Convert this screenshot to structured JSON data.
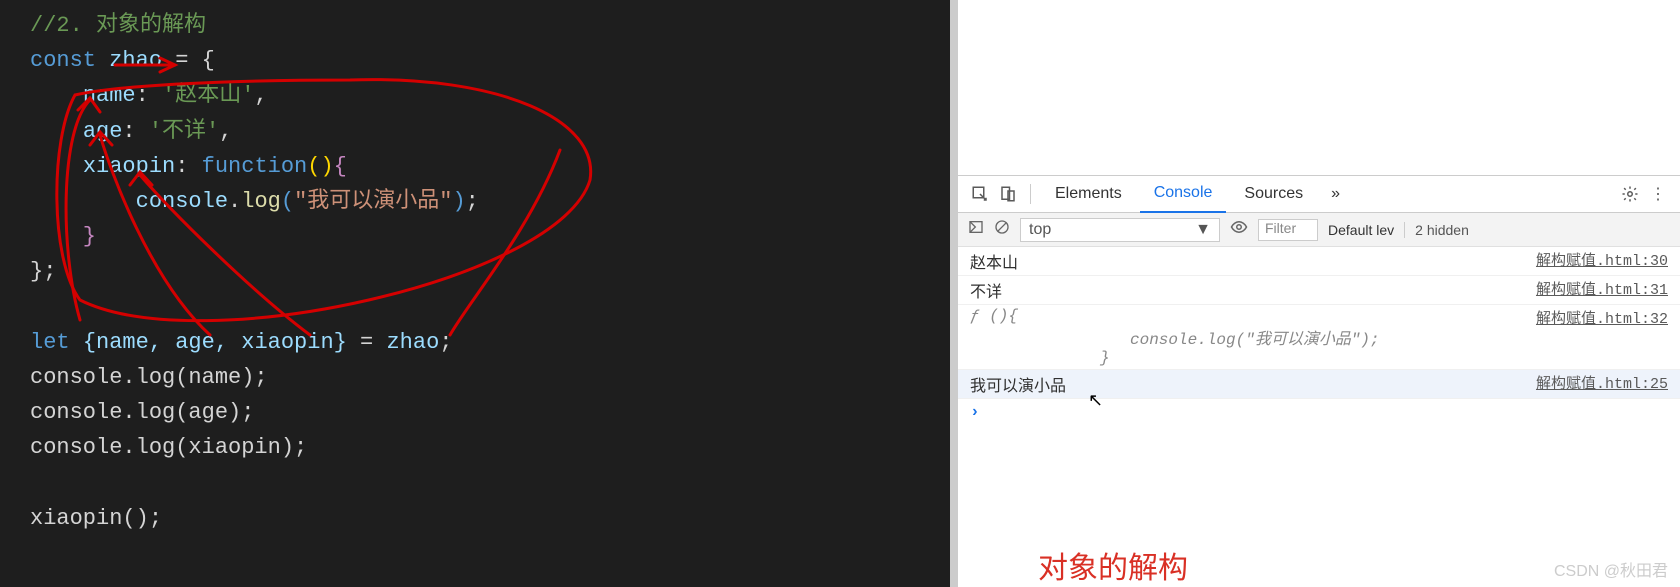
{
  "editor": {
    "lines": {
      "comment_prefix": "//2. ",
      "comment_text": "对象的解构",
      "l2_const": "const",
      "l2_var": "zhao",
      "l2_rest": " = {",
      "l3_prop": "name",
      "l3_val": "'赵本山'",
      "l4_prop": "age",
      "l4_val": "'不详'",
      "l5_prop": "xiaopin",
      "l5_func": "function",
      "l6_console": "console",
      "l6_log": "log",
      "l6_str": "\"我可以演小品\"",
      "l7": "    }",
      "l8": "};",
      "l10_let": "let",
      "l10_destr": "{name, age, xiaopin}",
      "l10_eq": " = ",
      "l10_src": "zhao",
      "l11": "console.log(name);",
      "l12": "console.log(age);",
      "l13": "console.log(xiaopin);",
      "l15": "xiaopin();"
    }
  },
  "devtools": {
    "tabs": {
      "elements": "Elements",
      "console": "Console",
      "sources": "Sources",
      "more": "»"
    },
    "toolbar": {
      "context": "top",
      "filter_placeholder": "Filter",
      "levels": "Default lev",
      "hidden": "2 hidden"
    },
    "rows": [
      {
        "msg": "赵本山",
        "src": "解构赋值.html:30"
      },
      {
        "msg": "不详",
        "src": "解构赋值.html:31"
      },
      {
        "msg_fn_head": "ƒ (){",
        "msg_fn_body": "console.log(\"我可以演小品\");",
        "msg_fn_close": "}",
        "src": "解构赋值.html:32"
      },
      {
        "msg": "我可以演小品",
        "src": "解构赋值.html:25",
        "highlight": true
      }
    ],
    "prompt": "›"
  },
  "caption": "对象的解构",
  "watermark": "CSDN @秋田君"
}
